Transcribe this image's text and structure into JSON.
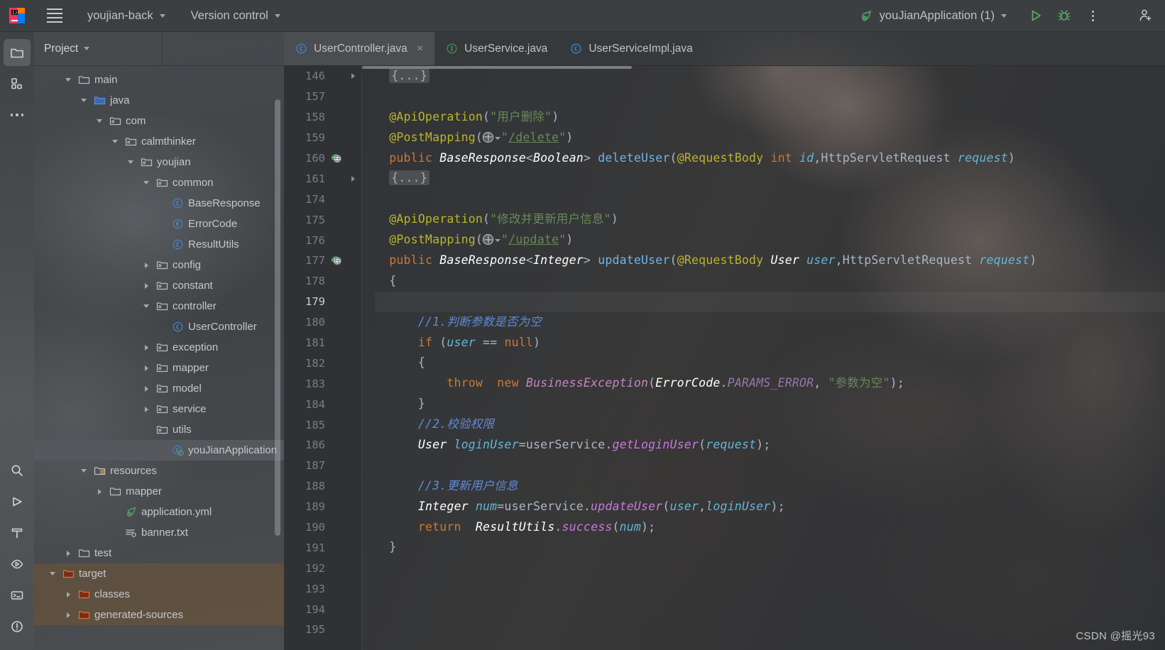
{
  "titlebar": {
    "menu_icon": "hamburger-menu-icon",
    "project_name": "youjian-back",
    "version_control": "Version control",
    "run_config": "youJianApplication (1)",
    "run_icon": "run-icon",
    "debug_icon": "debug-icon",
    "more_icon": "more-options-icon",
    "account_icon": "account-icon",
    "logo_icon": "intellij-idea-logo"
  },
  "toolstrip": {
    "top": [
      {
        "name": "project-tool-window-icon",
        "active": true
      },
      {
        "name": "commit-tool-window-icon",
        "active": false
      },
      {
        "name": "more-tool-windows-icon",
        "active": false
      }
    ],
    "bottom": [
      {
        "name": "search-icon",
        "active": false
      },
      {
        "name": "run-tool-window-icon",
        "active": false
      },
      {
        "name": "build-hammer-icon",
        "active": false
      },
      {
        "name": "services-icon",
        "active": false
      },
      {
        "name": "terminal-icon",
        "active": false
      },
      {
        "name": "problems-icon",
        "active": false
      }
    ]
  },
  "project_panel": {
    "title": "Project",
    "tree": [
      {
        "label": "main",
        "indent": 3,
        "twist": "down",
        "icon": "folder",
        "sel": false,
        "zone": ""
      },
      {
        "label": "java",
        "indent": 4,
        "twist": "down",
        "icon": "folder-source",
        "sel": false,
        "zone": ""
      },
      {
        "label": "com",
        "indent": 5,
        "twist": "down",
        "icon": "package",
        "sel": false,
        "zone": ""
      },
      {
        "label": "calmthinker",
        "indent": 6,
        "twist": "down",
        "icon": "package",
        "sel": false,
        "zone": ""
      },
      {
        "label": "youjian",
        "indent": 7,
        "twist": "down",
        "icon": "package",
        "sel": false,
        "zone": ""
      },
      {
        "label": "common",
        "indent": 8,
        "twist": "down",
        "icon": "package",
        "sel": false,
        "zone": ""
      },
      {
        "label": "BaseResponse",
        "indent": 9,
        "twist": "none",
        "icon": "class",
        "sel": false,
        "zone": ""
      },
      {
        "label": "ErrorCode",
        "indent": 9,
        "twist": "none",
        "icon": "enum",
        "sel": false,
        "zone": ""
      },
      {
        "label": "ResultUtils",
        "indent": 9,
        "twist": "none",
        "icon": "class",
        "sel": false,
        "zone": ""
      },
      {
        "label": "config",
        "indent": 8,
        "twist": "right",
        "icon": "package",
        "sel": false,
        "zone": ""
      },
      {
        "label": "constant",
        "indent": 8,
        "twist": "right",
        "icon": "package",
        "sel": false,
        "zone": ""
      },
      {
        "label": "controller",
        "indent": 8,
        "twist": "down",
        "icon": "package",
        "sel": false,
        "zone": ""
      },
      {
        "label": "UserController",
        "indent": 9,
        "twist": "none",
        "icon": "class",
        "sel": false,
        "zone": ""
      },
      {
        "label": "exception",
        "indent": 8,
        "twist": "right",
        "icon": "package",
        "sel": false,
        "zone": ""
      },
      {
        "label": "mapper",
        "indent": 8,
        "twist": "right",
        "icon": "package",
        "sel": false,
        "zone": ""
      },
      {
        "label": "model",
        "indent": 8,
        "twist": "right",
        "icon": "package",
        "sel": false,
        "zone": ""
      },
      {
        "label": "service",
        "indent": 8,
        "twist": "right",
        "icon": "package",
        "sel": false,
        "zone": ""
      },
      {
        "label": "utils",
        "indent": 8,
        "twist": "none",
        "icon": "package",
        "sel": false,
        "zone": ""
      },
      {
        "label": "youJianApplication",
        "indent": 9,
        "twist": "none",
        "icon": "spring-class",
        "sel": true,
        "zone": ""
      },
      {
        "label": "resources",
        "indent": 4,
        "twist": "down",
        "icon": "folder-res",
        "sel": false,
        "zone": ""
      },
      {
        "label": "mapper",
        "indent": 5,
        "twist": "right",
        "icon": "folder",
        "sel": false,
        "zone": ""
      },
      {
        "label": "application.yml",
        "indent": 6,
        "twist": "none",
        "icon": "spring-yml",
        "sel": false,
        "zone": ""
      },
      {
        "label": "banner.txt",
        "indent": 6,
        "twist": "none",
        "icon": "text-file",
        "sel": false,
        "zone": ""
      },
      {
        "label": "test",
        "indent": 3,
        "twist": "right",
        "icon": "folder",
        "sel": false,
        "zone": ""
      },
      {
        "label": "target",
        "indent": 2,
        "twist": "down",
        "icon": "folder-excl",
        "sel": false,
        "zone": "excluded"
      },
      {
        "label": "classes",
        "indent": 3,
        "twist": "right",
        "icon": "folder-excl",
        "sel": false,
        "zone": "excluded"
      },
      {
        "label": "generated-sources",
        "indent": 3,
        "twist": "right",
        "icon": "folder-excl",
        "sel": false,
        "zone": "excluded"
      }
    ]
  },
  "editor": {
    "tabs": [
      {
        "label": "UserController.java",
        "icon": "java-class-icon",
        "active": true,
        "closable": true
      },
      {
        "label": "UserService.java",
        "icon": "java-interface-icon",
        "active": false,
        "closable": false
      },
      {
        "label": "UserServiceImpl.java",
        "icon": "java-class-icon",
        "active": false,
        "closable": false
      }
    ],
    "close_glyph": "×",
    "lines": [
      {
        "n": "146",
        "fold": true,
        "gutter": "",
        "hl": false,
        "tokens": [
          {
            "t": "  ",
            "c": "plain"
          },
          {
            "t": "{...}",
            "c": "fold-chip"
          }
        ]
      },
      {
        "n": "157",
        "fold": false,
        "gutter": "",
        "hl": false,
        "tokens": []
      },
      {
        "n": "158",
        "fold": false,
        "gutter": "",
        "hl": false,
        "tokens": [
          {
            "t": "  @ApiOperation",
            "c": "anno"
          },
          {
            "t": "(",
            "c": "plain"
          },
          {
            "t": "\"用户删除\"",
            "c": "str"
          },
          {
            "t": ")",
            "c": "plain"
          }
        ]
      },
      {
        "n": "159",
        "fold": false,
        "gutter": "",
        "hl": false,
        "tokens": [
          {
            "t": "  @PostMapping",
            "c": "anno"
          },
          {
            "t": "(",
            "c": "plain"
          },
          {
            "t": "WEB",
            "c": "webicon"
          },
          {
            "t": "\"",
            "c": "str"
          },
          {
            "t": "/delete",
            "c": "link"
          },
          {
            "t": "\"",
            "c": "str"
          },
          {
            "t": ")",
            "c": "plain"
          }
        ]
      },
      {
        "n": "160",
        "fold": false,
        "gutter": "web",
        "hl": false,
        "tokens": [
          {
            "t": "  ",
            "c": "plain"
          },
          {
            "t": "public",
            "c": "kw"
          },
          {
            "t": " ",
            "c": "plain"
          },
          {
            "t": "BaseResponse",
            "c": "cls"
          },
          {
            "t": "<",
            "c": "plain"
          },
          {
            "t": "Boolean",
            "c": "cls"
          },
          {
            "t": "> ",
            "c": "plain"
          },
          {
            "t": "deleteUser",
            "c": "meth"
          },
          {
            "t": "(",
            "c": "plain"
          },
          {
            "t": "@RequestBody",
            "c": "anno"
          },
          {
            "t": " ",
            "c": "plain"
          },
          {
            "t": "int",
            "c": "kw"
          },
          {
            "t": " ",
            "c": "plain"
          },
          {
            "t": "id",
            "c": "fieldv"
          },
          {
            "t": ",HttpServletRequest ",
            "c": "plain"
          },
          {
            "t": "request",
            "c": "fieldv"
          },
          {
            "t": ")",
            "c": "plain"
          }
        ]
      },
      {
        "n": "161",
        "fold": true,
        "gutter": "",
        "hl": false,
        "tokens": [
          {
            "t": "  ",
            "c": "plain"
          },
          {
            "t": "{...}",
            "c": "fold-chip"
          }
        ]
      },
      {
        "n": "174",
        "fold": false,
        "gutter": "",
        "hl": false,
        "tokens": []
      },
      {
        "n": "175",
        "fold": false,
        "gutter": "",
        "hl": false,
        "tokens": [
          {
            "t": "  @ApiOperation",
            "c": "anno"
          },
          {
            "t": "(",
            "c": "plain"
          },
          {
            "t": "\"修改并更新用户信息\"",
            "c": "str"
          },
          {
            "t": ")",
            "c": "plain"
          }
        ]
      },
      {
        "n": "176",
        "fold": false,
        "gutter": "",
        "hl": false,
        "tokens": [
          {
            "t": "  @PostMapping",
            "c": "anno"
          },
          {
            "t": "(",
            "c": "plain"
          },
          {
            "t": "WEB",
            "c": "webicon"
          },
          {
            "t": "\"",
            "c": "str"
          },
          {
            "t": "/update",
            "c": "link"
          },
          {
            "t": "\"",
            "c": "str"
          },
          {
            "t": ")",
            "c": "plain"
          }
        ]
      },
      {
        "n": "177",
        "fold": false,
        "gutter": "web",
        "hl": false,
        "tokens": [
          {
            "t": "  ",
            "c": "plain"
          },
          {
            "t": "public",
            "c": "kw"
          },
          {
            "t": " ",
            "c": "plain"
          },
          {
            "t": "BaseResponse",
            "c": "cls"
          },
          {
            "t": "<",
            "c": "plain"
          },
          {
            "t": "Integer",
            "c": "cls"
          },
          {
            "t": "> ",
            "c": "plain"
          },
          {
            "t": "updateUser",
            "c": "meth"
          },
          {
            "t": "(",
            "c": "plain"
          },
          {
            "t": "@RequestBody",
            "c": "anno"
          },
          {
            "t": " ",
            "c": "plain"
          },
          {
            "t": "User",
            "c": "cls"
          },
          {
            "t": " ",
            "c": "plain"
          },
          {
            "t": "user",
            "c": "fieldv"
          },
          {
            "t": ",HttpServletRequest ",
            "c": "plain"
          },
          {
            "t": "request",
            "c": "fieldv"
          },
          {
            "t": ")",
            "c": "plain"
          }
        ]
      },
      {
        "n": "178",
        "fold": false,
        "gutter": "",
        "hl": false,
        "tokens": [
          {
            "t": "  {",
            "c": "plain"
          }
        ]
      },
      {
        "n": "179",
        "fold": false,
        "gutter": "",
        "hl": true,
        "tokens": []
      },
      {
        "n": "180",
        "fold": false,
        "gutter": "",
        "hl": false,
        "tokens": [
          {
            "t": "      //1.判断参数是否为空",
            "c": "cmt"
          }
        ]
      },
      {
        "n": "181",
        "fold": false,
        "gutter": "",
        "hl": false,
        "tokens": [
          {
            "t": "      ",
            "c": "plain"
          },
          {
            "t": "if",
            "c": "kw"
          },
          {
            "t": " (",
            "c": "plain"
          },
          {
            "t": "user",
            "c": "fieldv"
          },
          {
            "t": " == ",
            "c": "plain"
          },
          {
            "t": "null",
            "c": "kw"
          },
          {
            "t": ")",
            "c": "plain"
          }
        ]
      },
      {
        "n": "182",
        "fold": false,
        "gutter": "",
        "hl": false,
        "tokens": [
          {
            "t": "      {",
            "c": "plain"
          }
        ]
      },
      {
        "n": "183",
        "fold": false,
        "gutter": "",
        "hl": false,
        "tokens": [
          {
            "t": "          ",
            "c": "plain"
          },
          {
            "t": "throw",
            "c": "kw"
          },
          {
            "t": "  ",
            "c": "plain"
          },
          {
            "t": "new",
            "c": "kw"
          },
          {
            "t": " ",
            "c": "plain"
          },
          {
            "t": "BusinessException",
            "c": "pink"
          },
          {
            "t": "(",
            "c": "plain"
          },
          {
            "t": "ErrorCode",
            "c": "cls"
          },
          {
            "t": ".",
            "c": "plain"
          },
          {
            "t": "PARAMS_ERROR",
            "c": "field"
          },
          {
            "t": ", ",
            "c": "plain"
          },
          {
            "t": "\"参数为空\"",
            "c": "str"
          },
          {
            "t": ");",
            "c": "plain"
          }
        ]
      },
      {
        "n": "184",
        "fold": false,
        "gutter": "",
        "hl": false,
        "tokens": [
          {
            "t": "      }",
            "c": "plain"
          }
        ]
      },
      {
        "n": "185",
        "fold": false,
        "gutter": "",
        "hl": false,
        "tokens": [
          {
            "t": "      //2.校验权限",
            "c": "cmt"
          }
        ]
      },
      {
        "n": "186",
        "fold": false,
        "gutter": "",
        "hl": false,
        "tokens": [
          {
            "t": "      ",
            "c": "plain"
          },
          {
            "t": "User",
            "c": "cls"
          },
          {
            "t": " ",
            "c": "plain"
          },
          {
            "t": "loginUser",
            "c": "fieldv"
          },
          {
            "t": "=userService.",
            "c": "plain"
          },
          {
            "t": "getLoginUser",
            "c": "methi"
          },
          {
            "t": "(",
            "c": "plain"
          },
          {
            "t": "request",
            "c": "fieldv"
          },
          {
            "t": ");",
            "c": "plain"
          }
        ]
      },
      {
        "n": "187",
        "fold": false,
        "gutter": "",
        "hl": false,
        "tokens": []
      },
      {
        "n": "188",
        "fold": false,
        "gutter": "",
        "hl": false,
        "tokens": [
          {
            "t": "      //3.更新用户信息",
            "c": "cmt"
          }
        ]
      },
      {
        "n": "189",
        "fold": false,
        "gutter": "",
        "hl": false,
        "tokens": [
          {
            "t": "      ",
            "c": "plain"
          },
          {
            "t": "Integer",
            "c": "cls"
          },
          {
            "t": " ",
            "c": "plain"
          },
          {
            "t": "num",
            "c": "fieldv"
          },
          {
            "t": "=userService.",
            "c": "plain"
          },
          {
            "t": "updateUser",
            "c": "methi"
          },
          {
            "t": "(",
            "c": "plain"
          },
          {
            "t": "user",
            "c": "fieldv"
          },
          {
            "t": ",",
            "c": "plain"
          },
          {
            "t": "loginUser",
            "c": "fieldv"
          },
          {
            "t": ");",
            "c": "plain"
          }
        ]
      },
      {
        "n": "190",
        "fold": false,
        "gutter": "",
        "hl": false,
        "tokens": [
          {
            "t": "      ",
            "c": "plain"
          },
          {
            "t": "return",
            "c": "kw"
          },
          {
            "t": "  ",
            "c": "plain"
          },
          {
            "t": "ResultUtils",
            "c": "cls"
          },
          {
            "t": ".",
            "c": "plain"
          },
          {
            "t": "success",
            "c": "methi"
          },
          {
            "t": "(",
            "c": "plain"
          },
          {
            "t": "num",
            "c": "fieldv"
          },
          {
            "t": ");",
            "c": "plain"
          }
        ]
      },
      {
        "n": "191",
        "fold": false,
        "gutter": "",
        "hl": false,
        "tokens": [
          {
            "t": "  }",
            "c": "plain"
          }
        ]
      },
      {
        "n": "192",
        "fold": false,
        "gutter": "",
        "hl": false,
        "tokens": []
      },
      {
        "n": "193",
        "fold": false,
        "gutter": "",
        "hl": false,
        "tokens": []
      },
      {
        "n": "194",
        "fold": false,
        "gutter": "",
        "hl": false,
        "tokens": []
      },
      {
        "n": "195",
        "fold": false,
        "gutter": "",
        "hl": false,
        "tokens": []
      }
    ]
  },
  "watermark": "CSDN @摇光93",
  "colors": {
    "accent_green": "#59a869",
    "accent_blue": "#3592c4",
    "excluded_bg": "#7e582e",
    "panel_bg": "#434649",
    "editor_bg": "#2f3133"
  }
}
